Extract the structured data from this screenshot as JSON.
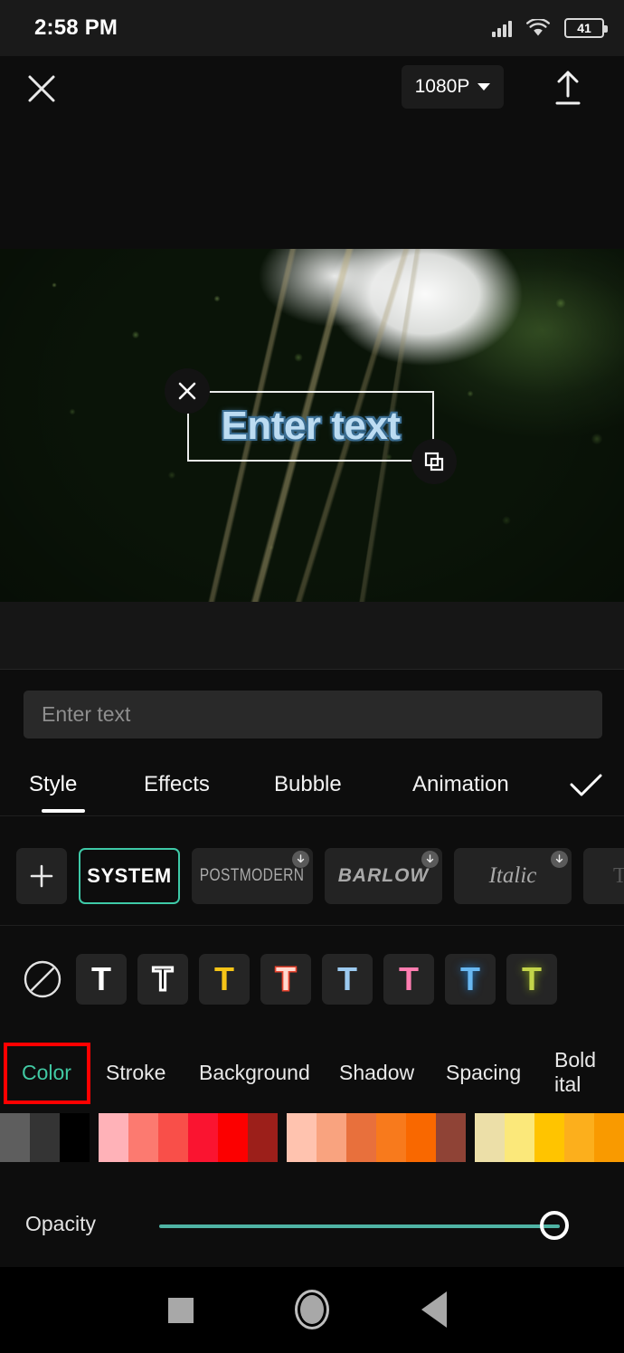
{
  "status_bar": {
    "time": "2:58 PM",
    "signal_icon": "cellular-signal-icon",
    "wifi_icon": "wifi-icon",
    "battery_level": "41"
  },
  "top_bar": {
    "close_icon": "close-icon",
    "resolution_label": "1080P",
    "resolution_caret_icon": "chevron-down-icon",
    "export_icon": "export-upload-icon"
  },
  "preview": {
    "overlay_text": "Enter text",
    "delete_handle_icon": "close-icon",
    "resize_handle_icon": "resize-copy-icon",
    "text_color": "#bcdcf2",
    "text_stroke_color": "#3a6d92"
  },
  "edit_panel": {
    "text_input": {
      "value": "",
      "placeholder": "Enter text"
    },
    "tabs": [
      {
        "label": "Style",
        "active": true
      },
      {
        "label": "Effects",
        "active": false
      },
      {
        "label": "Bubble",
        "active": false
      },
      {
        "label": "Animation",
        "active": false
      }
    ],
    "confirm_icon": "check-icon",
    "fonts": {
      "add_icon": "plus-icon",
      "download_icon": "download-arrow-icon",
      "items": [
        {
          "label": "SYSTEM",
          "selected": true,
          "downloadable": false
        },
        {
          "label": "POSTMODERN",
          "selected": false,
          "downloadable": true
        },
        {
          "label": "BARLOW",
          "selected": false,
          "downloadable": true
        },
        {
          "label": "Italic",
          "selected": false,
          "downloadable": true
        },
        {
          "label": "TYPE",
          "selected": false,
          "downloadable": false
        }
      ]
    },
    "presets": {
      "none_icon": "no-style-slash-icon",
      "items": [
        {
          "name": "preset-white",
          "glyph": "T",
          "color": "#ffffff",
          "stroke": "none"
        },
        {
          "name": "preset-outline",
          "glyph": "T",
          "color": "#1a1a1a",
          "stroke": "#ffffff"
        },
        {
          "name": "preset-yellow",
          "glyph": "T",
          "color": "#f6c417",
          "stroke": "none"
        },
        {
          "name": "preset-red",
          "glyph": "T",
          "color": "#ffd9cf",
          "stroke": "#e8442f"
        },
        {
          "name": "preset-lightblue",
          "glyph": "T",
          "color": "#9ccaf0",
          "stroke": "none"
        },
        {
          "name": "preset-pink",
          "glyph": "T",
          "color": "#ff7db0",
          "stroke": "none"
        },
        {
          "name": "preset-blue-glow",
          "glyph": "T",
          "color": "#69b8f2",
          "stroke": "none"
        },
        {
          "name": "preset-green-glow",
          "glyph": "T",
          "color": "#c3d44a",
          "stroke": "none"
        }
      ]
    },
    "sub_tabs": [
      {
        "label": "Color",
        "active": true
      },
      {
        "label": "Stroke",
        "active": false
      },
      {
        "label": "Background",
        "active": false
      },
      {
        "label": "Shadow",
        "active": false
      },
      {
        "label": "Spacing",
        "active": false
      },
      {
        "label": "Bold ital",
        "active": false
      }
    ],
    "accent_color": "#41c9a3",
    "annotation_color": "#ff0000",
    "color_swatches": [
      "#5e5e5e",
      "#343434",
      "#000000",
      "GAP",
      "#ffb2b8",
      "#fc7a70",
      "#f94f49",
      "#fa1430",
      "#fc0000",
      "#9c1f1a",
      "GAP",
      "#ffc3af",
      "#f9a37f",
      "#e8703c",
      "#f87a1c",
      "#f96800",
      "#8f4336",
      "GAP",
      "#ecdfa8",
      "#fbe87a",
      "#ffc400",
      "#fcaf1c",
      "#f99a00"
    ],
    "opacity": {
      "label": "Opacity",
      "value": 100
    }
  },
  "nav_bar": {
    "recents_icon": "square-recents-icon",
    "home_icon": "circle-home-icon",
    "back_icon": "triangle-back-icon"
  }
}
